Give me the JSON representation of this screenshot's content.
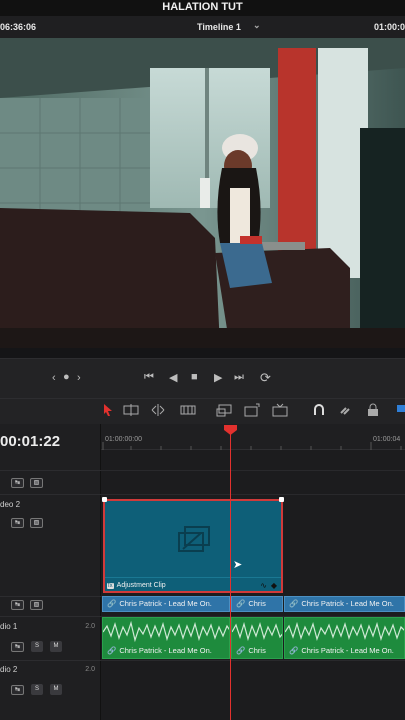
{
  "project": {
    "title": "HALATION TUT"
  },
  "viewer": {
    "source_timecode": "06:36:06",
    "timeline_name": "Timeline 1",
    "record_timecode": "01:00:0"
  },
  "timeline": {
    "current_timecode": "00:01:22",
    "ruler": {
      "start": "01:00:00:00",
      "next": "01:00:04"
    },
    "tracks": [
      {
        "label": "deo 2",
        "num": ""
      },
      {
        "label": "dio 1",
        "num": "2.0"
      },
      {
        "label": "dio 2",
        "num": "2.0"
      }
    ],
    "adjustment_clip": {
      "label": "Adjustment Clip",
      "fx_badge": "fx"
    },
    "video_clips": [
      "Chris Patrick - Lead Me On.",
      "Chris",
      "Chris Patrick - Lead Me On."
    ],
    "audio_clips": [
      "Chris Patrick - Lead Me On.",
      "Chris",
      "Chris Patrick - Lead Me On."
    ],
    "button_labels": {
      "solo": "S",
      "mute": "M"
    }
  },
  "colors": {
    "accent": "#e2312e",
    "adjustment_clip": "#0e5f78",
    "video_clip": "#2f74a8",
    "audio_clip": "#1e8b3d"
  }
}
